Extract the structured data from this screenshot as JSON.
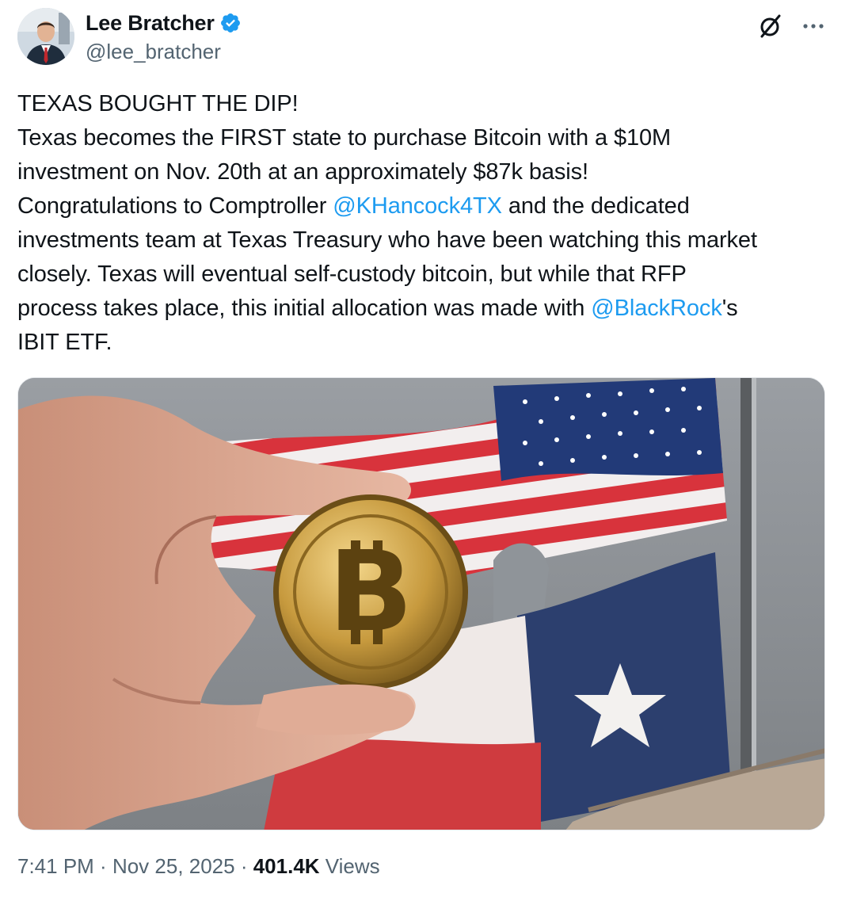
{
  "author": {
    "display_name": "Lee Bratcher",
    "handle": "@lee_bratcher",
    "verified_icon": "verified-badge-icon",
    "badge_color": "#1d9bf0"
  },
  "actions": {
    "grok_icon": "grok-icon",
    "more_icon": "more-options-icon"
  },
  "tweet": {
    "line1": "TEXAS BOUGHT THE DIP!",
    "line2": "Texas becomes the FIRST state to purchase Bitcoin with a $10M",
    "line3": "investment on Nov. 20th at an approximately $87k basis!",
    "line4_pre": "Congratulations to Comptroller ",
    "mention1": "@KHancock4TX",
    "line4_post": " and the dedicated",
    "line5": "investments team at Texas Treasury who have been watching this market",
    "line6": "closely. Texas will eventual self-custody bitcoin, but while that RFP",
    "line7_pre": "process takes place, this initial allocation was made with ",
    "mention2": "@BlackRock",
    "line7_post": "'s",
    "line8": "IBIT ETF.",
    "link_color": "#1d9bf0"
  },
  "media": {
    "coin_symbol": "B"
  },
  "meta": {
    "time": "7:41 PM",
    "separator": " · ",
    "date": "Nov 25, 2025",
    "views_count": "401.4K",
    "views_label": " Views"
  }
}
